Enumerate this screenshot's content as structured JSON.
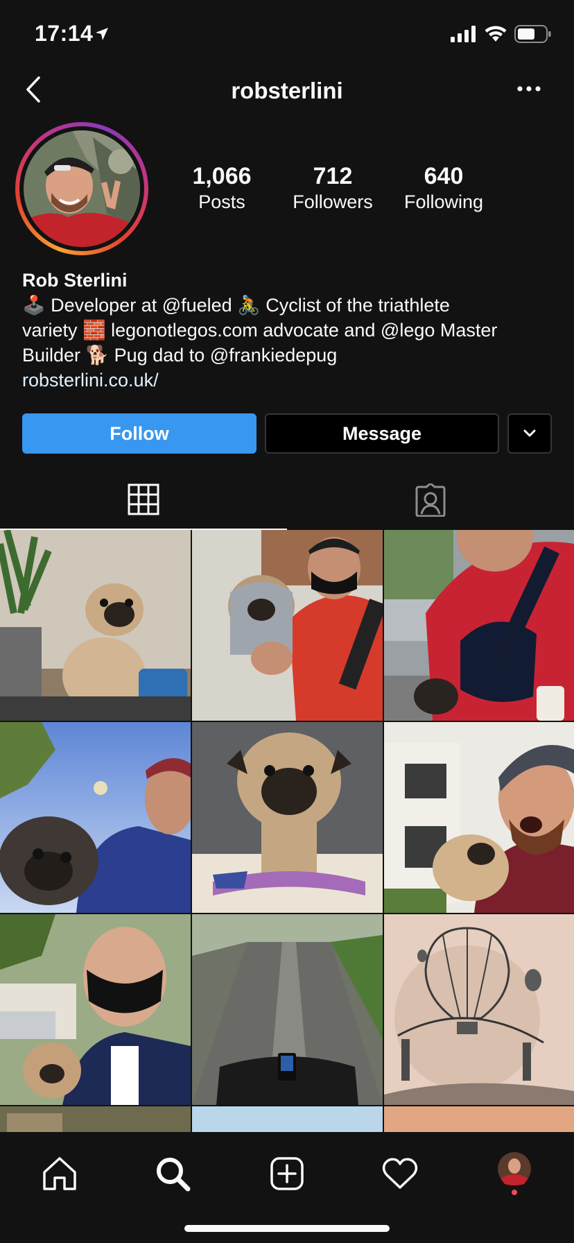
{
  "status_bar": {
    "time": "17:14"
  },
  "header": {
    "username": "robsterlini"
  },
  "stats": {
    "posts": {
      "value": "1,066",
      "label": "Posts"
    },
    "followers": {
      "value": "712",
      "label": "Followers"
    },
    "following": {
      "value": "640",
      "label": "Following"
    }
  },
  "bio": {
    "name": "Rob Sterlini",
    "line1": "🕹️ Developer at @fueled 🚴 Cyclist of the triathlete",
    "line2": "variety 🧱 legonotlegos.com advocate and @lego Master",
    "line3": "Builder 🐕 Pug dad to @frankiedepug",
    "link": "robsterlini.co.uk/"
  },
  "actions": {
    "follow_label": "Follow",
    "message_label": "Message"
  },
  "tabs": [
    "grid",
    "tagged"
  ],
  "colors": {
    "background": "#121212",
    "follow_button": "#3897f0",
    "text": "#fafafa",
    "border": "#363636"
  },
  "grid_posts": [
    "pug-puppy-sitting",
    "pug-held-red-jacket",
    "pug-in-sling-bag",
    "pug-selfie-blue-sky",
    "pug-on-blanket",
    "pug-held-cap-selfie",
    "pug-held-mask-selfie",
    "cycling-road",
    "balloon-bridge-tattoo"
  ]
}
